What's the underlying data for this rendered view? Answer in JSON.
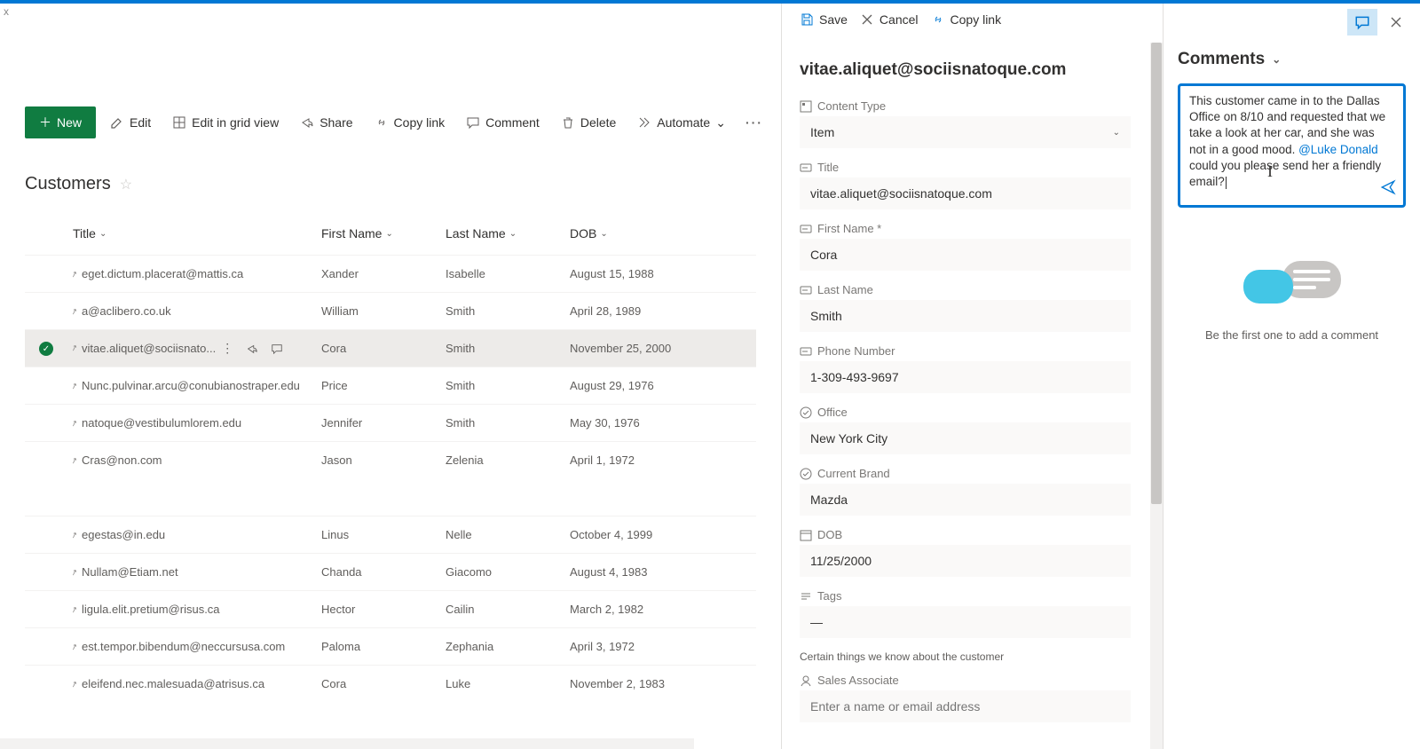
{
  "toolbar": {
    "new": "New",
    "edit": "Edit",
    "editGrid": "Edit in grid view",
    "share": "Share",
    "copyLink": "Copy link",
    "comment": "Comment",
    "delete": "Delete",
    "automate": "Automate"
  },
  "list": {
    "title": "Customers",
    "columns": {
      "title": "Title",
      "firstName": "First Name",
      "lastName": "Last Name",
      "dob": "DOB"
    },
    "rows": [
      {
        "title": "eget.dictum.placerat@mattis.ca",
        "first": "Xander",
        "last": "Isabelle",
        "dob": "August 15, 1988"
      },
      {
        "title": "a@aclibero.co.uk",
        "first": "William",
        "last": "Smith",
        "dob": "April 28, 1989"
      },
      {
        "title": "vitae.aliquet@sociisnato...",
        "first": "Cora",
        "last": "Smith",
        "dob": "November 25, 2000",
        "selected": true
      },
      {
        "title": "Nunc.pulvinar.arcu@conubianostraper.edu",
        "first": "Price",
        "last": "Smith",
        "dob": "August 29, 1976"
      },
      {
        "title": "natoque@vestibulumlorem.edu",
        "first": "Jennifer",
        "last": "Smith",
        "dob": "May 30, 1976"
      },
      {
        "title": "Cras@non.com",
        "first": "Jason",
        "last": "Zelenia",
        "dob": "April 1, 1972"
      },
      {
        "title": "egestas@in.edu",
        "first": "Linus",
        "last": "Nelle",
        "dob": "October 4, 1999"
      },
      {
        "title": "Nullam@Etiam.net",
        "first": "Chanda",
        "last": "Giacomo",
        "dob": "August 4, 1983"
      },
      {
        "title": "ligula.elit.pretium@risus.ca",
        "first": "Hector",
        "last": "Cailin",
        "dob": "March 2, 1982"
      },
      {
        "title": "est.tempor.bibendum@neccursusa.com",
        "first": "Paloma",
        "last": "Zephania",
        "dob": "April 3, 1972"
      },
      {
        "title": "eleifend.nec.malesuada@atrisus.ca",
        "first": "Cora",
        "last": "Luke",
        "dob": "November 2, 1983"
      }
    ]
  },
  "detail": {
    "toolbar": {
      "save": "Save",
      "cancel": "Cancel",
      "copyLink": "Copy link"
    },
    "heading": "vitae.aliquet@sociisnatoque.com",
    "labels": {
      "contentType": "Content Type",
      "title": "Title",
      "firstName": "First Name *",
      "lastName": "Last Name",
      "phone": "Phone Number",
      "office": "Office",
      "brand": "Current Brand",
      "dob": "DOB",
      "tags": "Tags",
      "sectionNote": "Certain things we know about the customer",
      "salesAssociate": "Sales Associate"
    },
    "values": {
      "contentType": "Item",
      "title": "vitae.aliquet@sociisnatoque.com",
      "firstName": "Cora",
      "lastName": "Smith",
      "phone": "1-309-493-9697",
      "office": "New York City",
      "brand": "Mazda",
      "dob": "11/25/2000",
      "tags": "—",
      "salesAssociatePlaceholder": "Enter a name or email address"
    }
  },
  "comments": {
    "title": "Comments",
    "draft": {
      "pre": "This customer came in to the Dallas Office on 8/10 and requested that we take a look at her car, and she was not in a good mood. ",
      "mention": "@Luke Donald",
      "post": " could you please send her a friendly email?"
    },
    "empty": "Be the first one to add a comment"
  }
}
